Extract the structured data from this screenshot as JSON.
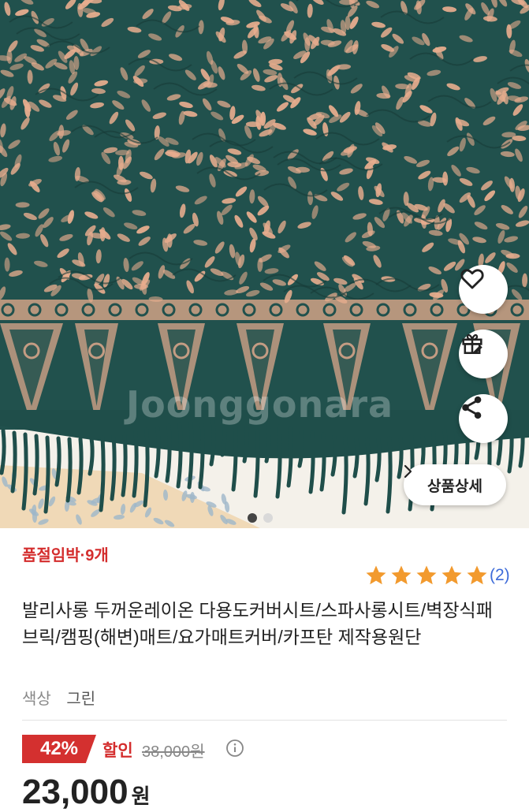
{
  "gallery": {
    "watermark": "Joonggonara",
    "dots_total": 2,
    "dots_active": 1,
    "detail_button_label": "상품상세",
    "colors": {
      "fabric": "#21514d",
      "motif": "#e8ad8e",
      "fringe": "#1f4e4a"
    }
  },
  "product": {
    "stock_status": "품절임박·9개",
    "rating_stars": 5,
    "review_count": "(2)",
    "title": "발리사롱 두꺼운레이온 다용도커버시트/스파사롱시트/벽장식패브릭/캠핑(해변)매트/요가매트커버/카프탄 제작용원단",
    "option_label": "색상",
    "option_value": "그린",
    "discount_percent": "42%",
    "discount_label": "할인",
    "original_price": "38,000원",
    "price": "23,000",
    "price_unit": "원"
  },
  "icons": {
    "heart": "heart-icon",
    "gift": "gift-icon",
    "share": "share-icon",
    "chevron": "chevron-right-icon",
    "info": "info-icon",
    "star": "star-icon"
  },
  "theme": {
    "accent_red": "#d42d2d",
    "star_color": "#f29a2e",
    "link_blue": "#3d6bd9"
  }
}
